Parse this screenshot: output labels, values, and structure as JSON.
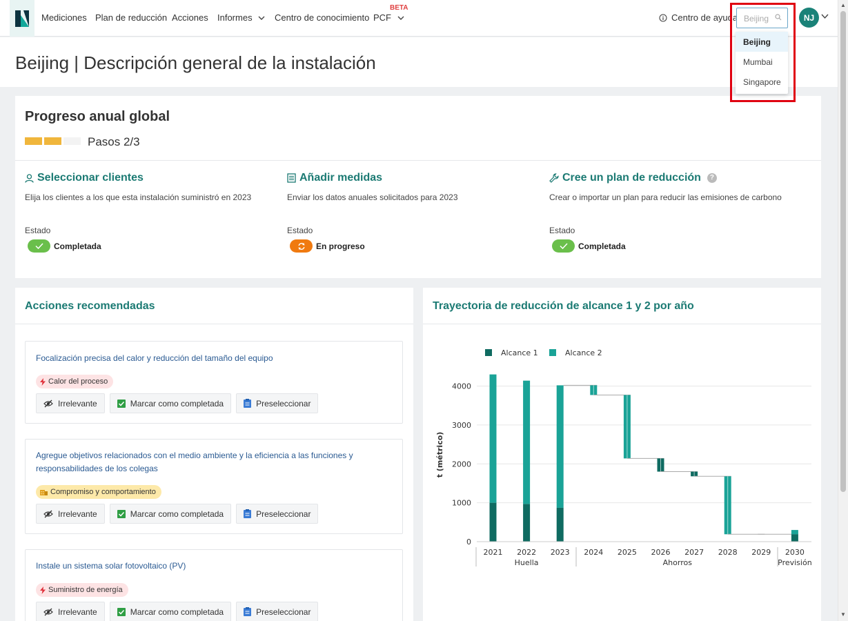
{
  "nav": {
    "items": [
      "Mediciones",
      "Plan de reducción",
      "Acciones",
      "Informes",
      "Centro de conocimiento",
      "PCF"
    ],
    "beta_label": "BETA",
    "help_label": "Centro de ayuda",
    "search_value": "Beijing",
    "avatar_initials": "NJ",
    "dropdown_options": [
      "Beijing",
      "Mumbai",
      "Singapore"
    ],
    "selected_option": "Beijing"
  },
  "page": {
    "title": "Beijing | Descripción general de la instalación"
  },
  "progress": {
    "title": "Progreso anual global",
    "steps_label": "Pasos 2/3",
    "steps_done": 2,
    "steps_total": 3,
    "bar_color": "#f0b63c",
    "steps": [
      {
        "title": "Seleccionar clientes",
        "icon": "user-icon",
        "description": "Elija los clientes a los que esta instalación suministró en 2023",
        "status_label": "Estado",
        "status": "Completada",
        "status_color": "#6abf4b"
      },
      {
        "title": "Añadir medidas",
        "icon": "list-icon",
        "description": "Enviar los datos anuales solicitados para 2023",
        "status_label": "Estado",
        "status": "En progreso",
        "status_color": "#f07a10"
      },
      {
        "title": "Cree un plan de reducción",
        "icon": "wrench-icon",
        "description": "Crear o importar un plan para reducir las emisiones de carbono",
        "status_label": "Estado",
        "status": "Completada",
        "status_color": "#6abf4b"
      }
    ]
  },
  "actions": {
    "title": "Acciones recomendadas",
    "buttons": {
      "irrelevant": "Irrelevante",
      "complete": "Marcar como completada",
      "shortlist": "Preseleccionar"
    },
    "items": [
      {
        "title": "Focalización precisa del calor y reducción del tamaño del equipo",
        "tag": "Calor del proceso",
        "tag_color": "#fde3e4"
      },
      {
        "title": "Agregue objetivos relacionados con el medio ambiente y la eficiencia a las funciones y responsabilidades de los colegas",
        "tag": "Compromiso y comportamiento",
        "tag_color": "#fde9a9"
      },
      {
        "title": "Instale un sistema solar fotovoltaico (PV)",
        "tag": "Suministro de energía",
        "tag_color": "#fde3e4"
      }
    ]
  },
  "chart": {
    "title": "Trayectoria de reducción de alcance 1 y 2 por año"
  },
  "chart_data": {
    "type": "bar",
    "subtype": "waterfall",
    "ylabel": "t (métrico)",
    "ylim": [
      0,
      4400
    ],
    "yticks": [
      0,
      1000,
      2000,
      3000,
      4000
    ],
    "grid": true,
    "legend_position": "top-left",
    "categories": [
      "2021",
      "2022",
      "2023",
      "2024",
      "2025",
      "2026",
      "2027",
      "2028",
      "2029",
      "2030"
    ],
    "groups": [
      {
        "label": "Huella",
        "categories": [
          "2021",
          "2022",
          "2023"
        ]
      },
      {
        "label": "Ahorros",
        "categories": [
          "2024",
          "2025",
          "2026",
          "2027",
          "2028",
          "2029"
        ]
      },
      {
        "label": "Previsión",
        "categories": [
          "2030"
        ]
      }
    ],
    "series": [
      {
        "name": "Alcance 1",
        "color": "#0f6b61"
      },
      {
        "name": "Alcance 2",
        "color": "#1aa397"
      }
    ],
    "footprint": [
      {
        "year": "2021",
        "alcance_1": 1000,
        "alcance_2": 3300
      },
      {
        "year": "2022",
        "alcance_1": 970,
        "alcance_2": 3170
      },
      {
        "year": "2023",
        "alcance_1": 870,
        "alcance_2": 3150
      }
    ],
    "savings": [
      {
        "year": "2024",
        "from": 4020,
        "to": 3770,
        "alcance_1": 0,
        "alcance_2": 250
      },
      {
        "year": "2025",
        "from": 3770,
        "to": 2140,
        "alcance_1": 0,
        "alcance_2": 1630
      },
      {
        "year": "2026",
        "from": 2140,
        "to": 1800,
        "alcance_1": 340,
        "alcance_2": 0
      },
      {
        "year": "2027",
        "from": 1800,
        "to": 1680,
        "alcance_1": 120,
        "alcance_2": 0
      },
      {
        "year": "2028",
        "from": 1680,
        "to": 190,
        "alcance_1": 0,
        "alcance_2": 1490
      },
      {
        "year": "2029",
        "from": 190,
        "to": 190,
        "alcance_1": 0,
        "alcance_2": 0
      }
    ],
    "forecast": [
      {
        "year": "2030",
        "alcance_1": 190,
        "alcance_2": 110
      }
    ]
  }
}
